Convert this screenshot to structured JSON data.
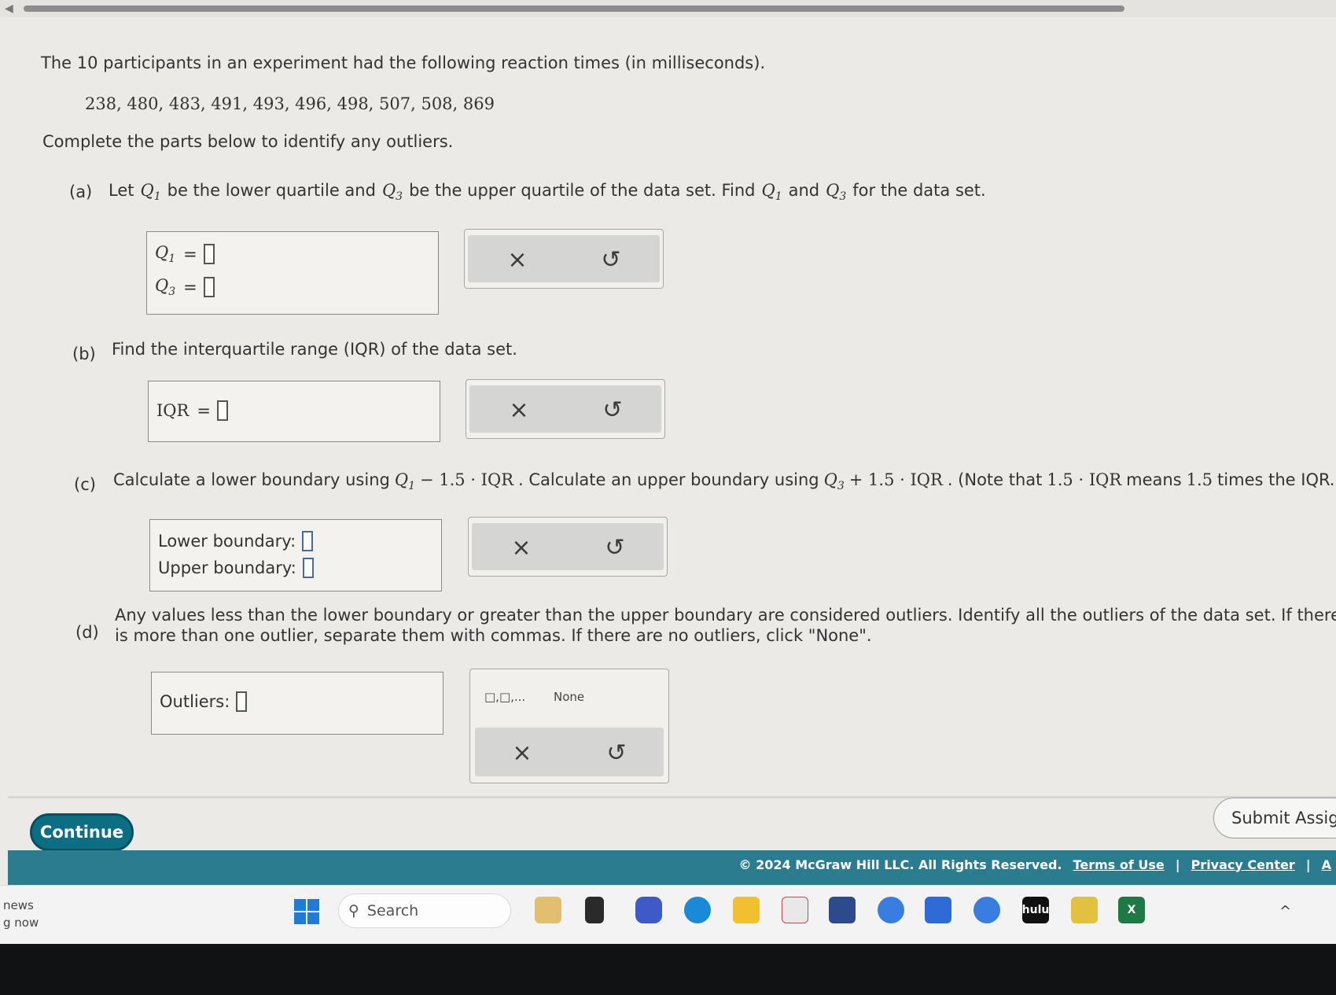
{
  "question": {
    "intro": "The 10 participants in an experiment had the following reaction times (in milliseconds).",
    "data_values": "238, 480, 483, 491, 493, 496, 498, 507, 508, 869",
    "instruction": "Complete the parts below to identify any outliers."
  },
  "part_a": {
    "label": "(a)",
    "text_1": "Let",
    "text_2": "be the lower quartile and",
    "text_3": "be the upper quartile of the data set. Find",
    "text_4": "and",
    "text_5": "for the data set.",
    "q1_symbol": "Q",
    "q1_sub": "1",
    "q3_symbol": "Q",
    "q3_sub": "3",
    "eq": "="
  },
  "part_b": {
    "label": "(b)",
    "text": "Find the interquartile range (IQR) of the data set.",
    "field_label": "IQR",
    "eq": "="
  },
  "part_c": {
    "label": "(c)",
    "text_1": "Calculate a lower boundary using",
    "expr_lower": "− 1.5 · IQR",
    "text_2": ". Calculate an upper boundary using",
    "expr_upper": "+ 1.5 · IQR",
    "text_3": ". (Note that",
    "expr_note": "1.5 · IQR",
    "text_4": "means",
    "expr_note2": "1.5",
    "text_5": "times the IQR.)",
    "lower_label": "Lower boundary:",
    "upper_label": "Upper boundary:"
  },
  "part_d": {
    "label": "(d)",
    "line_1": "Any values less than the lower boundary or greater than the upper boundary are considered outliers. Identify all the outliers of the data set. If there",
    "line_2": "is more than one outlier, separate them with commas. If there are no outliers, click \"None\".",
    "field_label": "Outliers:",
    "list_tool": "□,□,...",
    "none_label": "None"
  },
  "tools": {
    "clear": "×",
    "undo": "↺"
  },
  "buttons": {
    "continue": "Continue",
    "submit": "Submit Assig"
  },
  "footer": {
    "copyright": "© 2024 McGraw Hill LLC. All Rights Reserved.",
    "terms": "Terms of Use",
    "privacy": "Privacy Center",
    "more": "A"
  },
  "taskbar": {
    "news_1": "news",
    "news_2": "g now",
    "search": "Search",
    "hulu": "hulu",
    "excel": "X"
  },
  "colors": {
    "continue_bg": "#0b6e83",
    "footer_bg": "#2a7c8e",
    "page_bg": "#ebeae7"
  }
}
